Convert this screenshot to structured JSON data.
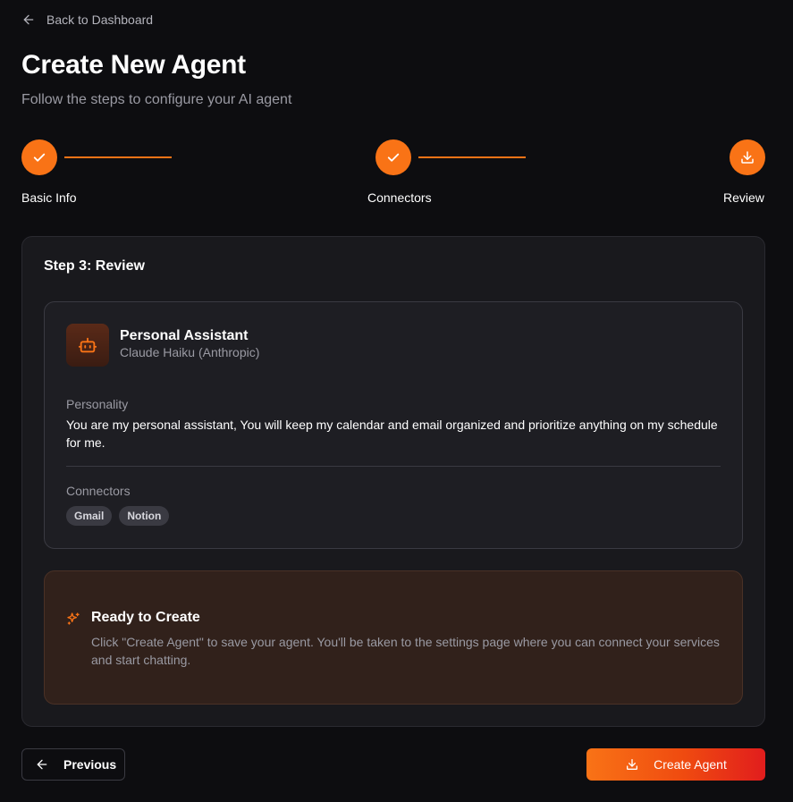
{
  "nav": {
    "back_label": "Back to Dashboard"
  },
  "header": {
    "title": "Create New Agent",
    "subtitle": "Follow the steps to configure your AI agent"
  },
  "stepper": {
    "steps": [
      {
        "label": "Basic Info",
        "status": "complete",
        "icon": "check-icon"
      },
      {
        "label": "Connectors",
        "status": "complete",
        "icon": "check-icon"
      },
      {
        "label": "Review",
        "status": "current",
        "icon": "download-icon"
      }
    ]
  },
  "review": {
    "title": "Step 3: Review",
    "agent": {
      "icon": "bot-icon",
      "name": "Personal Assistant",
      "model": "Claude Haiku (Anthropic)",
      "personality_label": "Personality",
      "personality": "You are my personal assistant, You will keep my calendar and email organized and prioritize anything on my schedule for me.",
      "connectors_label": "Connectors",
      "connectors": [
        "Gmail",
        "Notion"
      ]
    },
    "ready": {
      "icon": "sparkles-icon",
      "title": "Ready to Create",
      "text": "Click \"Create Agent\" to save your agent. You'll be taken to the settings page where you can connect your services and start chatting."
    }
  },
  "footer": {
    "previous_label": "Previous",
    "create_label": "Create Agent"
  },
  "colors": {
    "accent": "#f97316",
    "background": "#0d0d10",
    "card": "#19191d"
  }
}
